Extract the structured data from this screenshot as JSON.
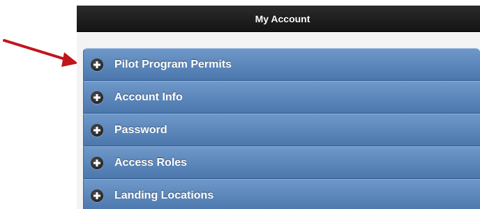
{
  "header": {
    "title": "My Account"
  },
  "accordion": {
    "items": [
      {
        "label": "Pilot Program Permits",
        "icon": "plus-icon"
      },
      {
        "label": "Account Info",
        "icon": "plus-icon"
      },
      {
        "label": "Password",
        "icon": "plus-icon"
      },
      {
        "label": "Access Roles",
        "icon": "plus-icon"
      },
      {
        "label": "Landing Locations",
        "icon": "plus-icon"
      }
    ]
  },
  "annotation": {
    "arrow_color": "#c0151b"
  },
  "colors": {
    "header_bg": "#1e1e1e",
    "accordion_bg": "#5a85bb",
    "text": "#ffffff"
  }
}
